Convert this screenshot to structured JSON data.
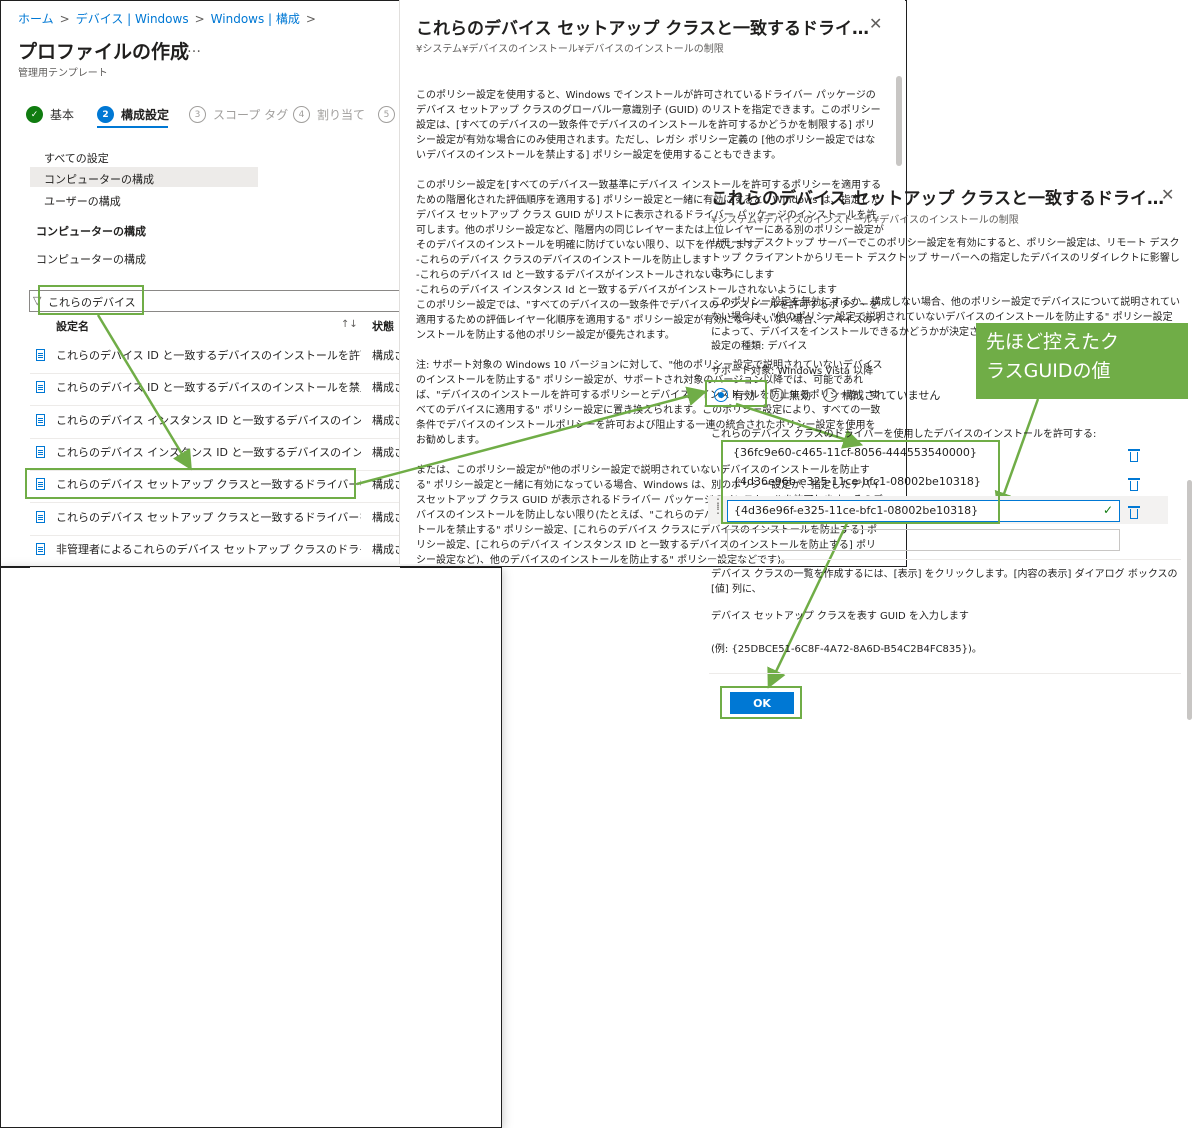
{
  "breadcrumb": [
    "ホーム",
    "デバイス | Windows",
    "Windows | 構成"
  ],
  "page": {
    "title": "プロファイルの作成",
    "more": "…",
    "subtitle": "管理用テンプレート"
  },
  "steps": [
    {
      "num": "✓",
      "label": "基本",
      "state": "done"
    },
    {
      "num": "2",
      "label": "構成設定",
      "state": "current"
    },
    {
      "num": "3",
      "label": "スコープ タグ",
      "state": "future"
    },
    {
      "num": "4",
      "label": "割り当て",
      "state": "future"
    },
    {
      "num": "5",
      "label": "",
      "state": "future"
    }
  ],
  "nav": {
    "all_settings": "すべての設定",
    "computer_config": "コンピューターの構成",
    "user_config": "ユーザーの構成",
    "section_heading": "コンピューターの構成",
    "section_item": "コンピューターの構成"
  },
  "filter": {
    "value": "これらのデバイス"
  },
  "table": {
    "col_name": "設定名",
    "col_status": "状態",
    "sort_icon": "↑↓",
    "rows": [
      {
        "name": "これらのデバイス ID と一致するデバイスのインストールを許可する",
        "status": "構成さ"
      },
      {
        "name": "これらのデバイス ID と一致するデバイスのインストールを禁止する",
        "status": "構成さ"
      },
      {
        "name": "これらのデバイス インスタンス ID と一致するデバイスのインストール…",
        "status": "構成さ"
      },
      {
        "name": "これらのデバイス インスタンス ID と一致するデバイスのインストール…",
        "status": "構成さ"
      },
      {
        "name": "これらのデバイス セットアップ クラスと一致するドライバーを使用した…",
        "status": "構成さ"
      },
      {
        "name": "これらのデバイス セットアップ クラスと一致するドライバーを使用した…",
        "status": "構成さ"
      },
      {
        "name": "非管理者によるこれらのデバイス セットアップ クラスのドライバーのイ…",
        "status": "構成さ"
      }
    ]
  },
  "mid_panel": {
    "title": "これらのデバイス セットアップ クラスと一致するドライ…",
    "path": "¥システム¥デバイスのインストール¥デバイスのインストールの制限",
    "close": "✕",
    "para1": "このポリシー設定を使用すると、Windows でインストールが許可されているドライバー パッケージのデバイス セットアップ クラスのグローバル一意識別子 (GUID) のリストを指定できます。このポリシー設定は、[すべてのデバイスの一致条件でデバイスのインストールを許可するかどうかを制限する] ポリシー設定が有効な場合にのみ使用されます。ただし、レガシ ポリシー定義の [他のポリシー設定ではないデバイスのインストールを禁止する] ポリシー設定を使用することもできます。",
    "para2": "このポリシー設定を[すべてのデバイス一致基準にデバイス インストールを許可するポリシーを適用するための階層化された評価順序を適用する] ポリシー設定と一緒に有効にすると、Windows は、指定したデバイス セットアップ クラス GUID がリストに表示されるドライバー パッケージのインストールを許可します。他のポリシー設定など、階層内の同じレイヤーまたは上位レイヤーにある別のポリシー設定がそのデバイスのインストールを明確に防げていない限り、以下を作成します。",
    "para3": "-これらのデバイス クラスのデバイスのインストールを防止します",
    "para4": "-これらのデバイス Id と一致するデバイスがインストールされないようにします",
    "para5": "-これらのデバイス インスタンス Id と一致するデバイスがインストールされないようにします",
    "para6": "このポリシー設定では、\"すべてのデバイスの一致条件でデバイスのインストールを許可するポリシーを適用するための評価レイヤー化順序を適用する\" ポリシー設定が有効になっていない場合、デバイスのインストールを防止する他のポリシー設定が優先されます。",
    "para7": "注: サポート対象の Windows 10 バージョンに対して、\"他のポリシー設定で説明されていないデバイスのインストールを防止する\" ポリシー設定が、サポートされ対象のバージョン以降では、可能であれば、\"デバイスのインストールを許可するポリシーとデバイスのインストールを防止するポリシーを、すべてのデバイスに適用する\" ポリシー設定に置き換えられます。このポリシー設定により、すべての一致条件でデバイスのインストールポリシーを許可および阻止する一連の統合されたポリシー設定を使用をお勧めします。",
    "para8": "または、このポリシー設定が\"他のポリシー設定で説明されていないデバイスのインストールを防止する\" ポリシー設定と一緒に有効になっている場合、Windows は、別のポリシー設定が、指定したデバイスセットアップ クラス GUID が表示されるドライバー パッケージのインストールを許可します。そのデバイスのインストールを防止しない限り(たとえば、\"これらのデバイス ID と一致するデバイスのインストールを禁止する\" ポリシー設定、[これらのデバイス クラスにデバイスのインストールを防止する] ポリシー設定、[これらのデバイス インスタンス ID と一致するデバイスのインストールを防止する] ポリシー設定など)、他のデバイスのインストールを防止する\" ポリシー設定などです)。"
  },
  "front_panel": {
    "title": "これらのデバイス セットアップ クラスと一致するドライ…",
    "path": "¥システム¥デバイスのインストール¥デバイスのインストールの制限",
    "close": "✕",
    "para1": "リモート デスクトップ サーバーでこのポリシー設定を有効にすると、ポリシー設定は、リモート デスクトップ クライアントからリモート デスクトップ サーバーへの指定したデバイスのリダイレクトに影響します。",
    "para2": "このポリシー設定を無効にするか、構成しない場合、他のポリシー設定でデバイスについて説明されていない場合は、\"他のポリシー設定で説明されていないデバイスのインストールを防止する\" ポリシー設定によって、デバイスをインストールできるかどうかが決定されます。",
    "setting_type": "設定の種類: デバイス",
    "supported": "サポート対象: Windows Vista 以降",
    "radio_enabled": "有効",
    "radio_disabled": "無効",
    "radio_notconfigured": "構成されていません",
    "list_label": "これらのデバイス クラスのドライバーを使用したデバイスのインストールを許可する:",
    "guids": [
      "{36fc9e60-c465-11cf-8056-444553540000}",
      "{4d36e96b-e325-11ce-bfc1-08002be10318}",
      "{4d36e96f-e325-11ce-bfc1-08002be10318}"
    ],
    "help1": "デバイス クラスの一覧を作成するには、[表示] をクリックします。[内容の表示] ダイアログ ボックスの [値] 列に、",
    "help2": "デバイス セットアップ クラスを表す GUID を入力します",
    "help3": "(例: {25DBCE51-6C8F-4A72-8A6D-B54C2B4FC835})。",
    "ok": "OK"
  },
  "callout": {
    "line1": "先ほど控えたク",
    "line2": "ラスGUIDの値"
  },
  "colors": {
    "accent": "#0078d4",
    "success": "#107c10",
    "annotation": "#70ad47"
  },
  "icons": [
    "chevron-right-icon",
    "check-icon",
    "filter-icon",
    "sort-icon",
    "document-icon",
    "close-icon",
    "radio-icon",
    "trash-icon",
    "drag-handle-icon",
    "valid-check-icon"
  ]
}
